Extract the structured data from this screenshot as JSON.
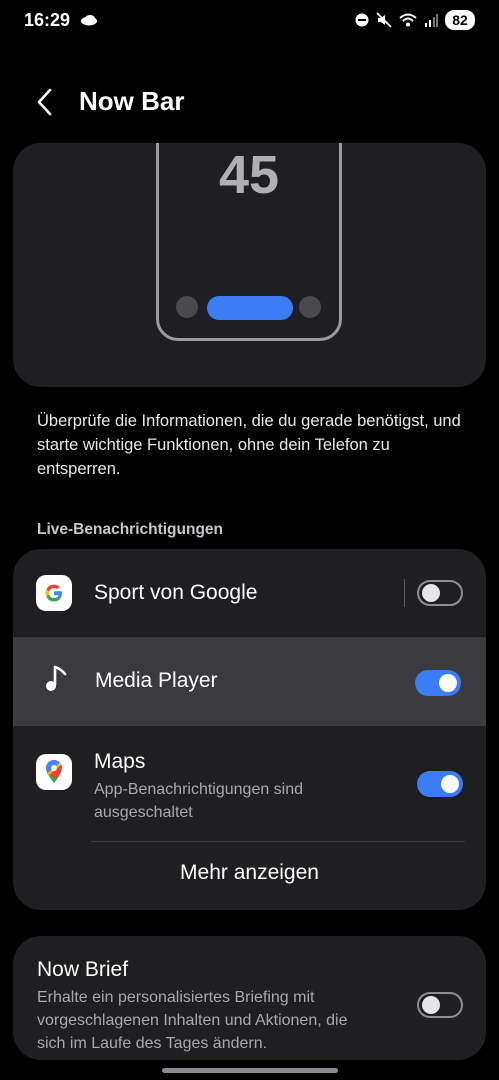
{
  "status": {
    "time": "16:29",
    "battery": "82"
  },
  "header": {
    "title": "Now Bar"
  },
  "preview": {
    "clock": "45"
  },
  "description": "Überprüfe die Informationen, die du gerade benötigst, und starte wichtige Funktionen, ohne dein Telefon zu entsperren.",
  "live_section": {
    "label": "Live-Benachrichtigungen",
    "items": [
      {
        "label": "Sport von Google",
        "icon": "google-icon",
        "toggle": false
      },
      {
        "label": "Media Player",
        "icon": "music-note-icon",
        "toggle": true
      },
      {
        "label": "Maps",
        "sublabel": "App-Benachrichtigungen sind ausgeschaltet",
        "icon": "maps-icon",
        "toggle": true
      }
    ],
    "more": "Mehr anzeigen"
  },
  "now_brief": {
    "title": "Now Brief",
    "description": "Erhalte ein personalisiertes Briefing mit vorgeschlagenen Inhalten und Aktionen, die sich im Laufe des Tages ändern.",
    "toggle": false
  },
  "colors": {
    "accent": "#3a7df6",
    "card": "#1f1f22",
    "background": "#000000"
  }
}
